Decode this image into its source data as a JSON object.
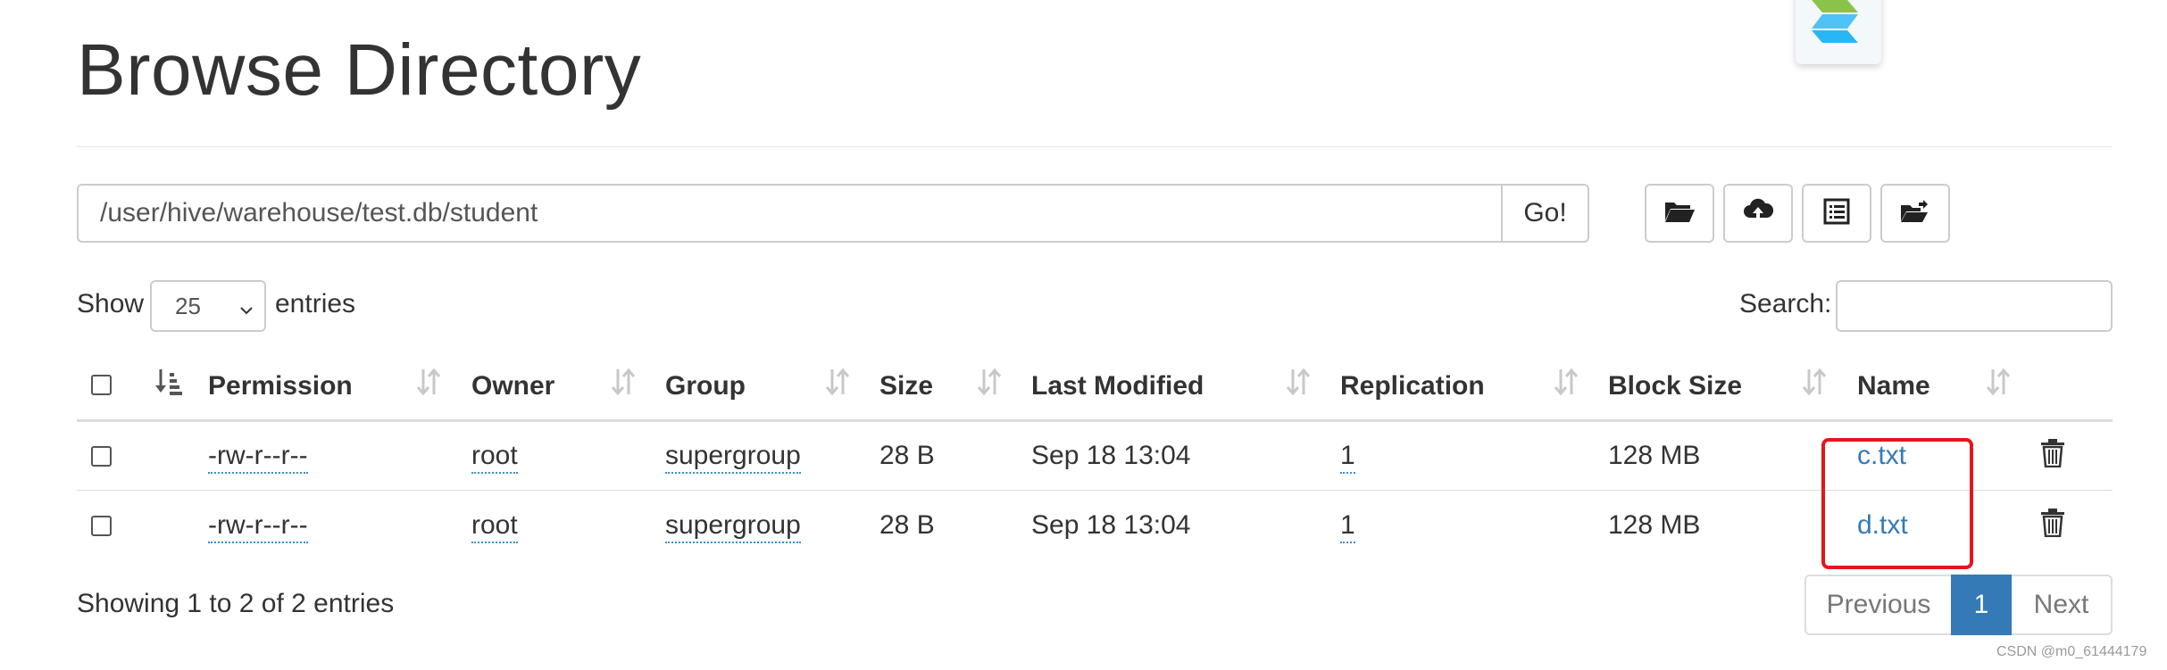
{
  "page": {
    "title": "Browse Directory"
  },
  "toolbar": {
    "path_value": "/user/hive/warehouse/test.db/student",
    "go_label": "Go!",
    "tools": [
      {
        "icon": "folder-open-icon"
      },
      {
        "icon": "cloud-upload-icon"
      },
      {
        "icon": "list-icon"
      },
      {
        "icon": "folder-move-icon"
      }
    ]
  },
  "table_controls": {
    "show_label": "Show",
    "page_length": "25",
    "entries_label": "entries",
    "search_label": "Search:",
    "search_value": ""
  },
  "table": {
    "columns": [
      "Permission",
      "Owner",
      "Group",
      "Size",
      "Last Modified",
      "Replication",
      "Block Size",
      "Name"
    ],
    "rows": [
      {
        "permission": "-rw-r--r--",
        "owner": "root",
        "group": "supergroup",
        "size": "28 B",
        "modified": "Sep 18 13:04",
        "replication": "1",
        "block_size": "128 MB",
        "name": "c.txt"
      },
      {
        "permission": "-rw-r--r--",
        "owner": "root",
        "group": "supergroup",
        "size": "28 B",
        "modified": "Sep 18 13:04",
        "replication": "1",
        "block_size": "128 MB",
        "name": "d.txt"
      }
    ]
  },
  "footer": {
    "info": "Showing 1 to 2 of 2 entries",
    "pagination": {
      "previous": "Previous",
      "current": "1",
      "next": "Next"
    }
  },
  "watermark": "CSDN @m0_61444179",
  "colors": {
    "link": "#337ab7",
    "highlight_box": "#e8141b",
    "active_page": "#337ab7"
  }
}
